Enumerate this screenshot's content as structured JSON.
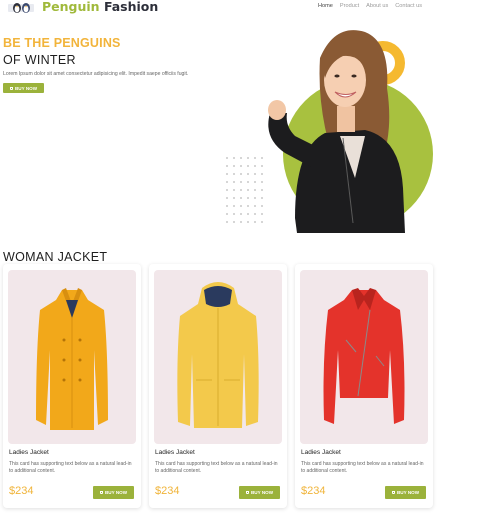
{
  "header": {
    "brand_part1": "Penguin",
    "brand_part2": "Fashion",
    "nav": [
      "Home",
      "Product",
      "About us",
      "Contact us"
    ]
  },
  "hero": {
    "title_line1": "BE THE PENGUINS",
    "title_line2": "OF WINTER",
    "description": "Lorem Ipsum dolor sit amet consectetur adipisicing elit. Impedit saepe officiis fugit.",
    "button": "BUY NOW"
  },
  "section": {
    "title": "WOMAN JACKET",
    "cards": [
      {
        "title": "Ladies Jacket",
        "text": "This card has supporting text below as a natural lead-in to additional content.",
        "price": "$234",
        "button": "BUY NOW"
      },
      {
        "title": "Ladies Jacket",
        "text": "This card has supporting text below as a natural lead-in to additional content.",
        "price": "$234",
        "button": "BUY NOW"
      },
      {
        "title": "Ladies Jacket",
        "text": "This card has supporting text below as a natural lead-in to additional content.",
        "price": "$234",
        "button": "BUY NOW"
      }
    ]
  },
  "colors": {
    "accent_green": "#9bb23b",
    "accent_yellow": "#f2b43b",
    "card_bg": "#f2e7ea",
    "jacket1": "#f2a81a",
    "jacket2": "#f3c94b",
    "jacket3": "#e4332b"
  }
}
